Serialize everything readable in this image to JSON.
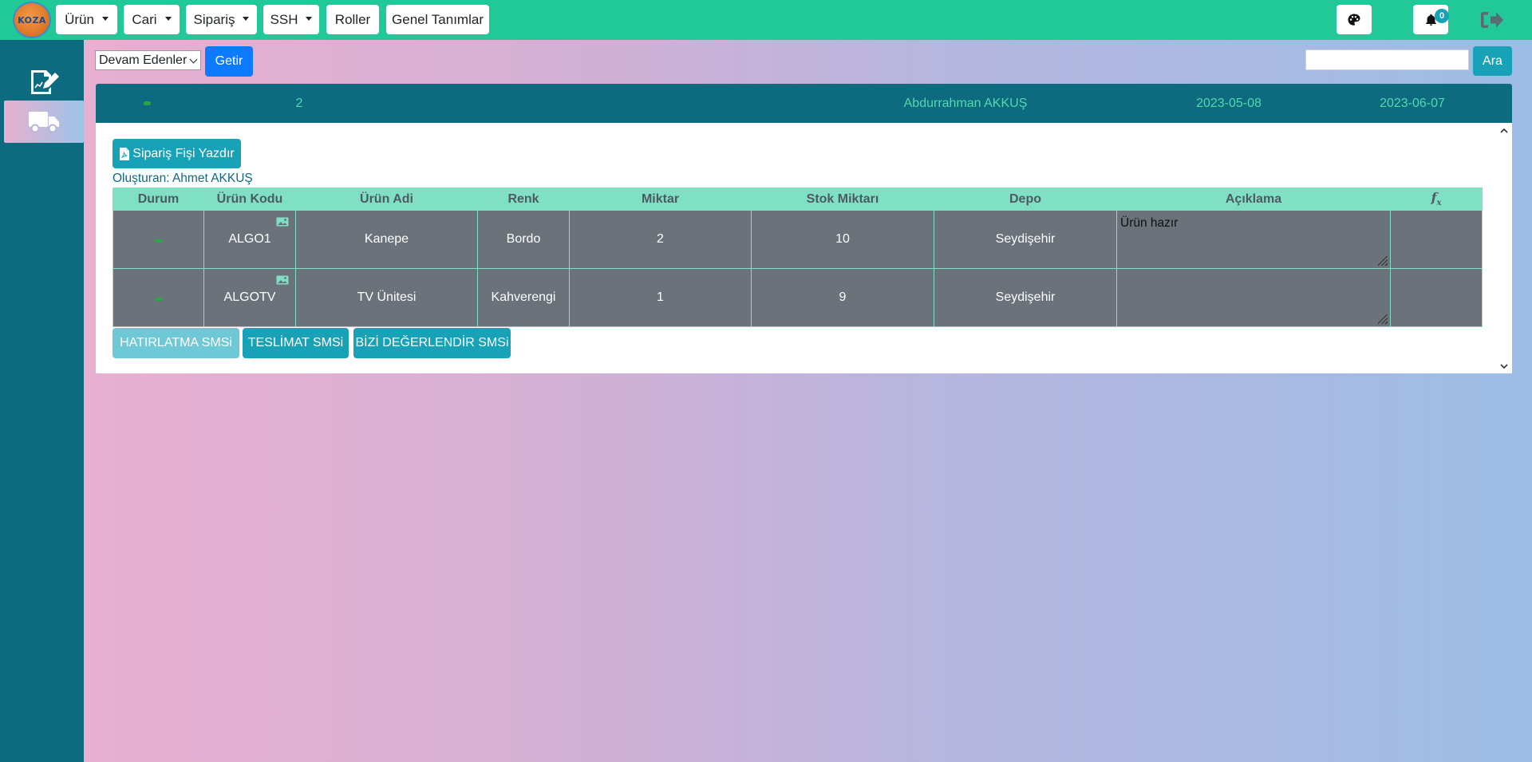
{
  "logo": {
    "text": "KOZA"
  },
  "nav": {
    "menus": [
      {
        "label": "Ürün",
        "dropdown": true
      },
      {
        "label": "Cari",
        "dropdown": true
      },
      {
        "label": "Sipariş",
        "dropdown": true
      },
      {
        "label": "SSH",
        "dropdown": true
      },
      {
        "label": "Roller",
        "dropdown": false
      },
      {
        "label": "Genel Tanımlar",
        "dropdown": false
      }
    ],
    "notification_count": "0",
    "icons": [
      "palette-icon",
      "bell-icon",
      "sign-out-icon"
    ]
  },
  "sidebar": {
    "items": [
      {
        "icon": "edit-document-icon",
        "active": false
      },
      {
        "icon": "truck-icon",
        "active": true
      }
    ]
  },
  "filter": {
    "selected": "Devam Edenler",
    "button": "Getir"
  },
  "search": {
    "value": "",
    "button": "Ara"
  },
  "order": {
    "number": "2",
    "customer": "Abdurrahman AKKUŞ",
    "order_date": "2023-05-08",
    "delivery_date": "2023-06-07",
    "print_button": "Sipariş Fişi Yazdır",
    "created_by": "Oluşturan: Ahmet AKKUŞ",
    "columns": [
      "Durum",
      "Ürün Kodu",
      "Ürün Adi",
      "Renk",
      "Miktar",
      "Stok Miktarı",
      "Depo",
      "Açıklama"
    ],
    "fx_label": "f",
    "fx_sub": "x",
    "rows": [
      {
        "code": "ALGO1",
        "name": "Kanepe",
        "color": "Bordo",
        "qty": "2",
        "stock": "10",
        "depot": "Seydişehir",
        "note": "Ürün hazır"
      },
      {
        "code": "ALGOTV",
        "name": "TV Ünitesi",
        "color": "Kahverengi",
        "qty": "1",
        "stock": "9",
        "depot": "Seydişehir",
        "note": ""
      }
    ],
    "sms_buttons": [
      "HATIRLATMA SMSi",
      "TESLİMAT SMSi",
      "BİZİ DEĞERLENDİR SMSi"
    ]
  },
  "colors": {
    "topbar": "#20c997",
    "sidebar": "#0e6a7e",
    "primary": "#0d7bff",
    "info": "#17a2b8",
    "table_header": "#80e0c4",
    "table_cell": "#6b727a"
  }
}
